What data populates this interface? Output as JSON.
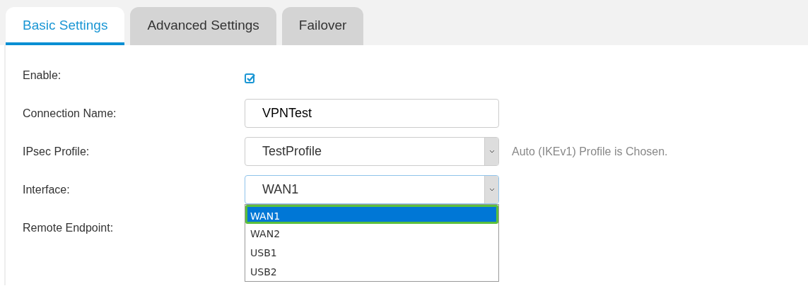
{
  "tabs": [
    {
      "label": "Basic Settings",
      "selected": true
    },
    {
      "label": "Advanced Settings",
      "selected": false
    },
    {
      "label": "Failover",
      "selected": false
    }
  ],
  "fields": [
    {
      "kind": "checkbox",
      "label": "Enable:",
      "checked": true
    },
    {
      "kind": "text",
      "label": "Connection Name:",
      "value": "VPNTest"
    },
    {
      "kind": "select",
      "label": "IPsec Profile:",
      "value": "TestProfile",
      "note": "Auto (IKEv1) Profile is Chosen."
    },
    {
      "kind": "select",
      "label": "Interface:",
      "value": "WAN1",
      "expanded": true,
      "options": [
        {
          "label": "WAN1",
          "selected": true
        },
        {
          "label": "WAN2",
          "selected": false
        },
        {
          "label": "USB1",
          "selected": false
        },
        {
          "label": "USB2",
          "selected": false
        }
      ]
    },
    {
      "kind": "none",
      "label": "Remote Endpoint:"
    }
  ]
}
